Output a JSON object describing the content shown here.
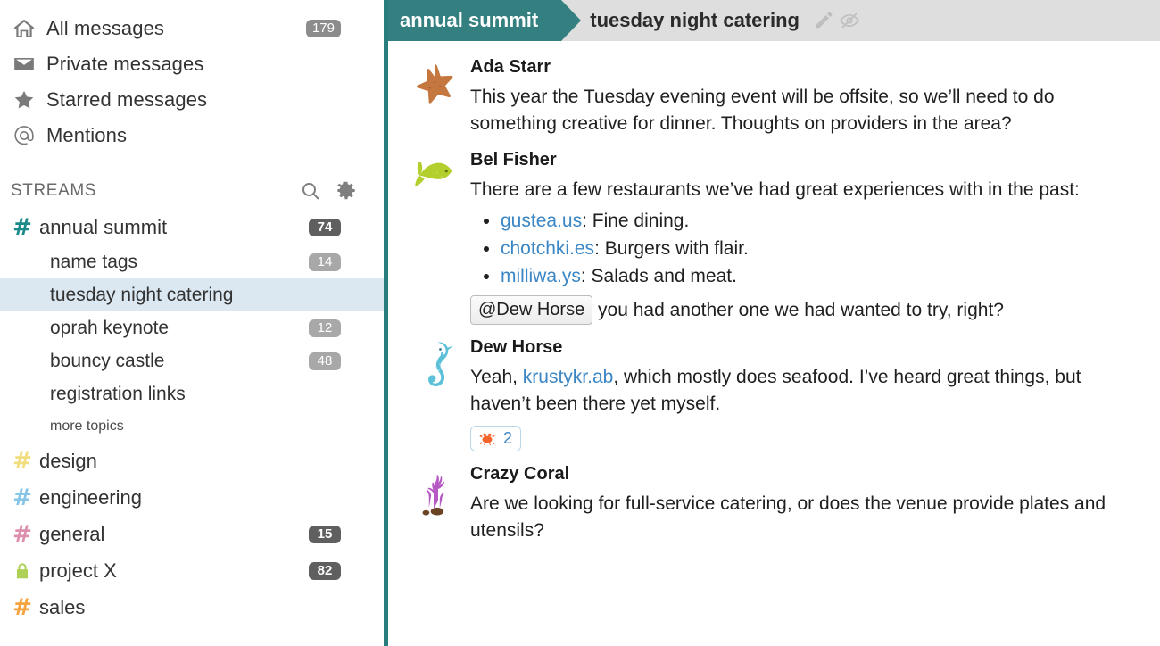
{
  "colors": {
    "stream_teal": "#347f80",
    "panel_border": "#2a7d7d",
    "topbar_bg": "#dedede",
    "selected_topic_bg": "#dbe8f2",
    "link_blue": "#3b86c4",
    "badge_gray": "#8c8c8c",
    "badge_dark": "#5f5f5f"
  },
  "sidebar": {
    "nav": [
      {
        "icon": "home-icon",
        "label": "All messages",
        "badge": "179",
        "badge_style": "normal"
      },
      {
        "icon": "envelope-icon",
        "label": "Private messages",
        "badge": "",
        "badge_style": "none"
      },
      {
        "icon": "star-icon",
        "label": "Starred messages",
        "badge": "",
        "badge_style": "none"
      },
      {
        "icon": "at-sign-icon",
        "label": "Mentions",
        "badge": "",
        "badge_style": "none"
      }
    ],
    "streams_header": {
      "title": "STREAMS",
      "search_icon": "search-icon",
      "gear_icon": "gear-icon"
    },
    "streams": [
      {
        "name": "annual summit",
        "icon": "hash-icon",
        "color": "#1d8a8a",
        "badge": "74",
        "badge_style": "dark",
        "topics": [
          {
            "name": "name tags",
            "badge": "14",
            "badge_style": "light",
            "selected": false
          },
          {
            "name": "tuesday night catering",
            "badge": "",
            "badge_style": "none",
            "selected": true
          },
          {
            "name": "oprah keynote",
            "badge": "12",
            "badge_style": "light",
            "selected": false
          },
          {
            "name": "bouncy castle",
            "badge": "48",
            "badge_style": "light",
            "selected": false
          },
          {
            "name": "registration links",
            "badge": "",
            "badge_style": "none",
            "selected": false
          }
        ],
        "more_topics_label": "more topics"
      },
      {
        "name": "design",
        "icon": "hash-icon",
        "color": "#f2de7e",
        "badge": "",
        "badge_style": "none",
        "topics": []
      },
      {
        "name": "engineering",
        "icon": "hash-icon",
        "color": "#86c5e8",
        "badge": "",
        "badge_style": "none",
        "topics": []
      },
      {
        "name": "general",
        "icon": "hash-icon",
        "color": "#dd8fae",
        "badge": "15",
        "badge_style": "dark",
        "topics": []
      },
      {
        "name": "project X",
        "icon": "lock-icon",
        "color": "#aed155",
        "badge": "82",
        "badge_style": "dark",
        "topics": []
      },
      {
        "name": "sales",
        "icon": "hash-icon",
        "color": "#f5a33c",
        "badge": "",
        "badge_style": "none",
        "topics": []
      }
    ]
  },
  "topbar": {
    "stream_label": "annual summit",
    "topic_label": "tuesday night catering",
    "edit_icon": "pencil-icon",
    "mute_icon": "eye-slash-icon"
  },
  "messages": [
    {
      "sender": "Ada Starr",
      "avatar": "starfish-avatar",
      "text": "This year the Tuesday evening event will be offsite, so we’ll need to do something creative for dinner. Thoughts on providers in the area?"
    },
    {
      "sender": "Bel Fisher",
      "avatar": "fish-avatar",
      "text": "There are a few restaurants we’ve had great experiences with in the past:",
      "list": [
        {
          "link": "gustea.us",
          "rest": ": Fine dining."
        },
        {
          "link": "chotchki.es",
          "rest": ": Burgers with flair."
        },
        {
          "link": "milliwa.ys",
          "rest": ": Salads and meat."
        }
      ],
      "mention": "@Dew Horse",
      "mention_rest": " you had another one we had wanted to try, right?"
    },
    {
      "sender": "Dew Horse",
      "avatar": "seahorse-avatar",
      "text_pre": "Yeah, ",
      "link": "krustykr.ab",
      "text_post": ", which mostly does seafood. I’ve heard great things, but haven’t been there yet myself.",
      "reaction": {
        "emoji": "crab-emoji",
        "count": "2"
      }
    },
    {
      "sender": "Crazy Coral",
      "avatar": "coral-avatar",
      "text": "Are we looking for full-service catering, or does the venue provide plates and utensils?"
    }
  ]
}
